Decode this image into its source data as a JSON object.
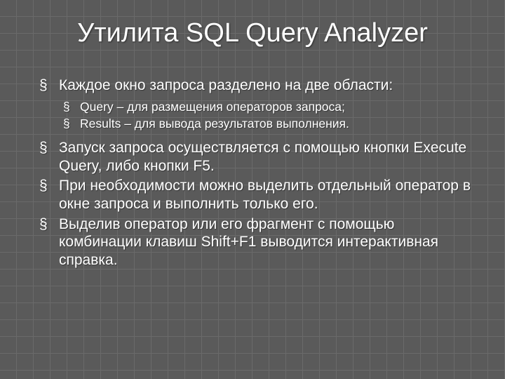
{
  "title": "Утилита SQL Query Analyzer",
  "bullets": [
    {
      "text": "Каждое окно запроса разделено на две области:",
      "sub": [
        "Query – для размещения операторов запроса;",
        "Results – для вывода результатов выполнения."
      ]
    },
    {
      "text": "Запуск запроса осуществляется с помощью кнопки Execute Query, либо кнопки F5."
    },
    {
      "text": "При необходимости можно выделить отдельный оператор в окне запроса и выполнить только его."
    },
    {
      "text": "Выделив оператор или его фрагмент с помощью комбинации клавиш Shift+F1 выводится интерактивная справка."
    }
  ]
}
